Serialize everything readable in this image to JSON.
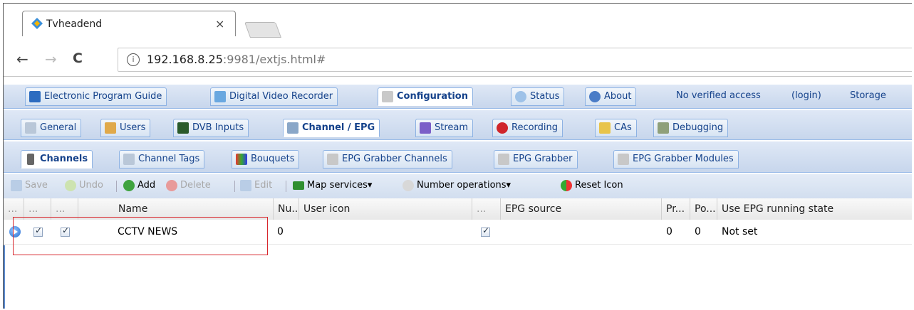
{
  "browser": {
    "tab_title": "Tvheadend",
    "tab_close": "×",
    "nav_back": "←",
    "nav_forward": "→",
    "nav_reload": "C",
    "info_icon": "i",
    "url_host": "192.168.8.25",
    "url_rest": ":9981/extjs.html#"
  },
  "main_tabs": [
    {
      "label": "Electronic Program Guide",
      "icon": "epg-icon"
    },
    {
      "label": "Digital Video Recorder",
      "icon": "dvr-icon"
    },
    {
      "label": "Configuration",
      "icon": "wrench-icon"
    },
    {
      "label": "Status",
      "icon": "eye-icon"
    },
    {
      "label": "About",
      "icon": "info-icon"
    }
  ],
  "main_info": {
    "access": "No verified access",
    "login": "(login)",
    "storage": "Storage"
  },
  "config_tabs": [
    {
      "label": "General",
      "icon": "tools-icon"
    },
    {
      "label": "Users",
      "icon": "users-icon"
    },
    {
      "label": "DVB Inputs",
      "icon": "tv-card-icon"
    },
    {
      "label": "Channel / EPG",
      "icon": "tv-icon"
    },
    {
      "label": "Stream",
      "icon": "stream-icon"
    },
    {
      "label": "Recording",
      "icon": "rec-icon"
    },
    {
      "label": "CAs",
      "icon": "key-icon"
    },
    {
      "label": "Debugging",
      "icon": "bug-icon"
    }
  ],
  "channel_tabs": [
    {
      "label": "Channels",
      "icon": "remote-icon"
    },
    {
      "label": "Channel Tags",
      "icon": "tags-icon"
    },
    {
      "label": "Bouquets",
      "icon": "grid-icon"
    },
    {
      "label": "EPG Grabber Channels",
      "icon": "grabber-icon"
    },
    {
      "label": "EPG Grabber",
      "icon": "grabber-icon"
    },
    {
      "label": "EPG Grabber Modules",
      "icon": "grabber-icon"
    }
  ],
  "actions": {
    "save": "Save",
    "undo": "Undo",
    "add": "Add",
    "delete": "Delete",
    "edit": "Edit",
    "map_services": "Map services",
    "number_operations": "Number operations",
    "reset_icon": "Reset Icon",
    "dropdown_arrow": "▾"
  },
  "grid": {
    "headers": [
      "...",
      "...",
      "...",
      "Name",
      "Nu...",
      "User icon",
      "...",
      "EPG source",
      "Pr...",
      "Po...",
      "Use EPG running state"
    ],
    "rows": [
      {
        "name": "CCTV NEWS",
        "number": "0",
        "user_icon": "",
        "epg_source": "",
        "priority": "0",
        "postfix": "0",
        "epg_running": "Not set"
      }
    ]
  },
  "colors": {
    "selection_box": "#d8272d",
    "link": "#15428b",
    "toolbar": "#dfe8f6"
  }
}
